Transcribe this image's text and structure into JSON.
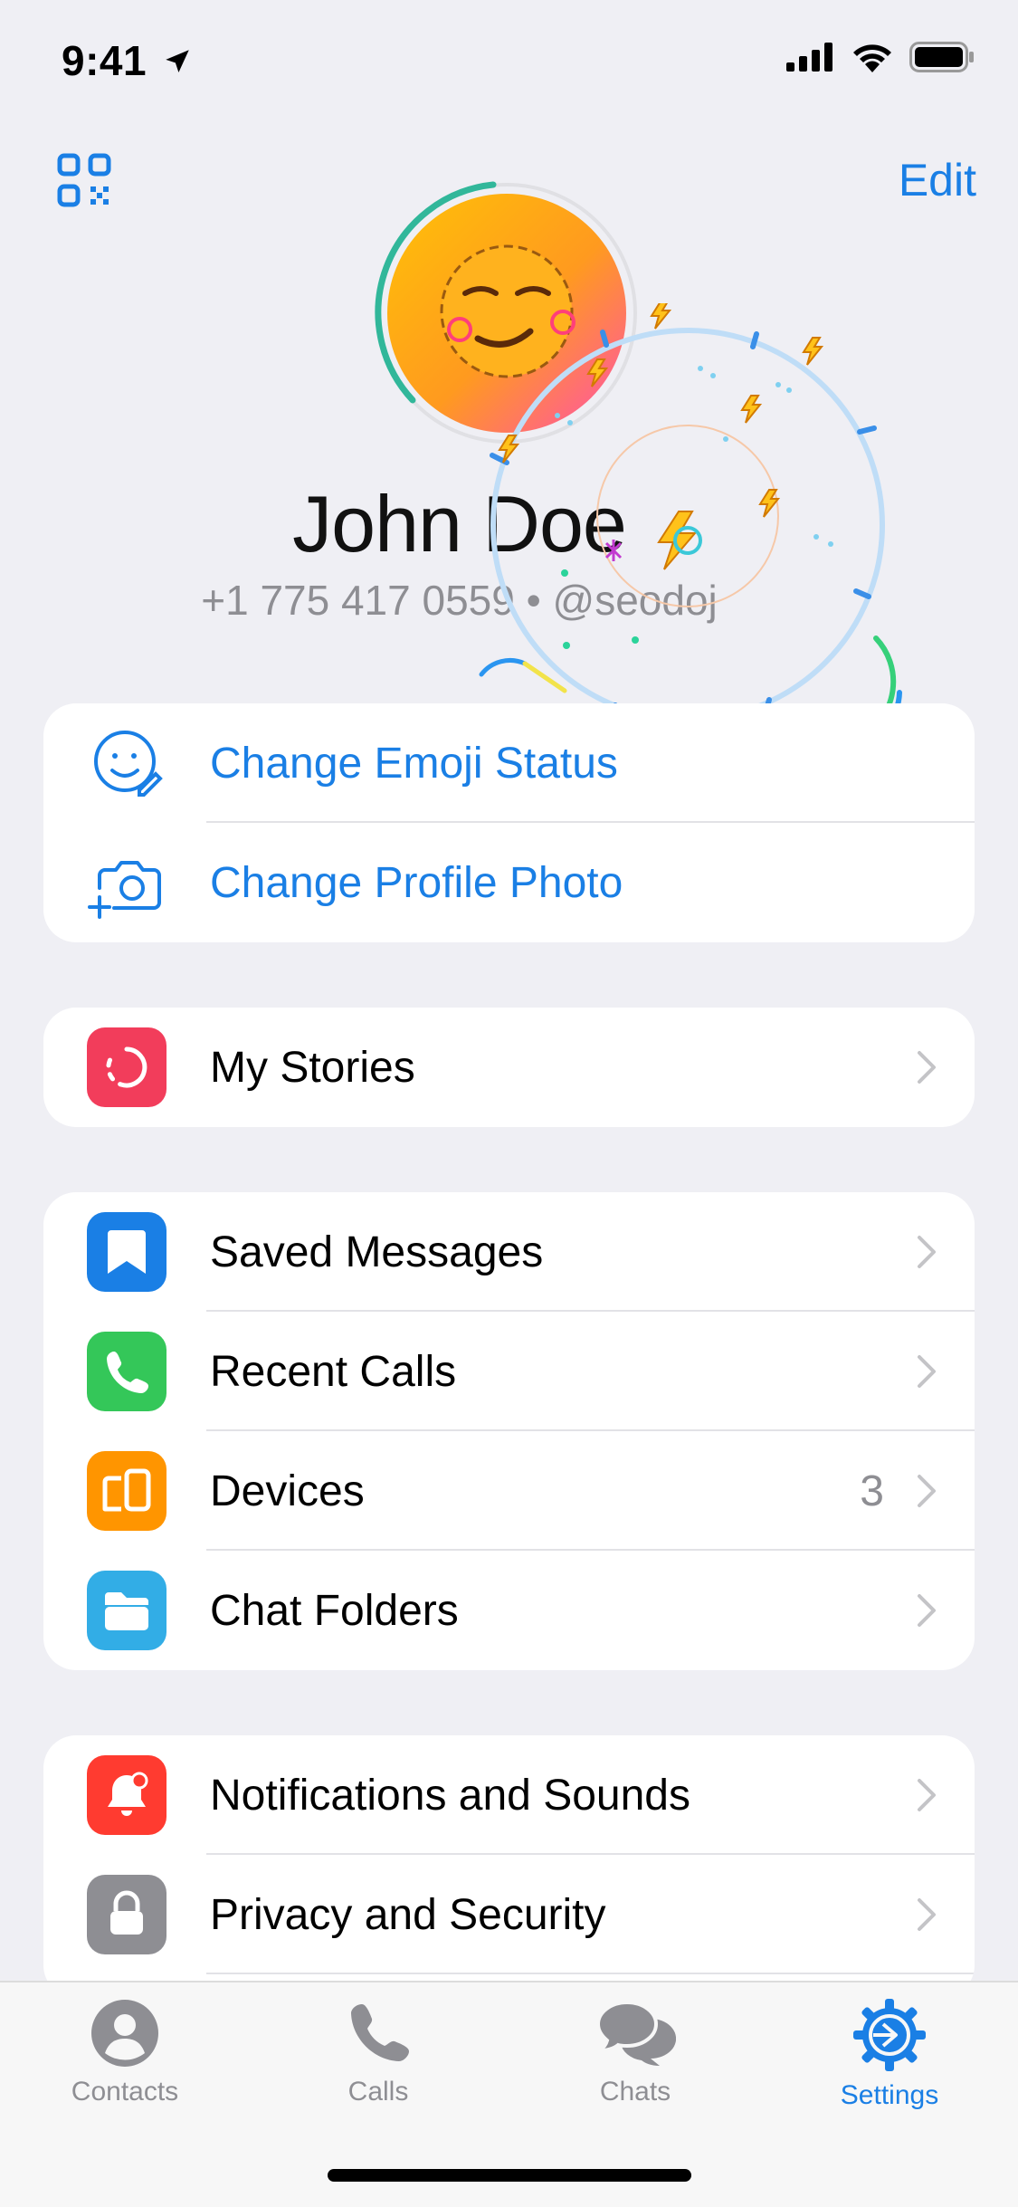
{
  "status_bar": {
    "time": "9:41"
  },
  "header": {
    "edit_label": "Edit"
  },
  "profile": {
    "name": "John Doe",
    "phone": "+1 775 417 0559",
    "separator": "•",
    "username": "@seodoj"
  },
  "actions": [
    {
      "label": "Change Emoji Status",
      "icon": "smile-edit-icon"
    },
    {
      "label": "Change Profile Photo",
      "icon": "camera-add-icon"
    }
  ],
  "stories": {
    "label": "My Stories",
    "icon": "stories-icon",
    "color": "#F23D5B"
  },
  "main_items": [
    {
      "label": "Saved Messages",
      "icon": "bookmark-icon",
      "color": "#1A7FE5"
    },
    {
      "label": "Recent Calls",
      "icon": "phone-icon",
      "color": "#34C759"
    },
    {
      "label": "Devices",
      "icon": "devices-icon",
      "color": "#FF9500",
      "count": "3"
    },
    {
      "label": "Chat Folders",
      "icon": "folder-icon",
      "color": "#32ADE6"
    }
  ],
  "settings_items": [
    {
      "label": "Notifications and Sounds",
      "icon": "bell-icon",
      "color": "#FF3B30"
    },
    {
      "label": "Privacy and Security",
      "icon": "lock-icon",
      "color": "#8E8E93"
    }
  ],
  "tabs": [
    {
      "label": "Contacts",
      "icon": "person-icon",
      "active": false
    },
    {
      "label": "Calls",
      "icon": "phone-icon",
      "active": false
    },
    {
      "label": "Chats",
      "icon": "chat-bubbles-icon",
      "active": false
    },
    {
      "label": "Settings",
      "icon": "gear-icon",
      "active": true
    }
  ],
  "colors": {
    "accent": "#1A7FE5",
    "background": "#EFEFF4",
    "secondary_text": "#8E8E93"
  }
}
